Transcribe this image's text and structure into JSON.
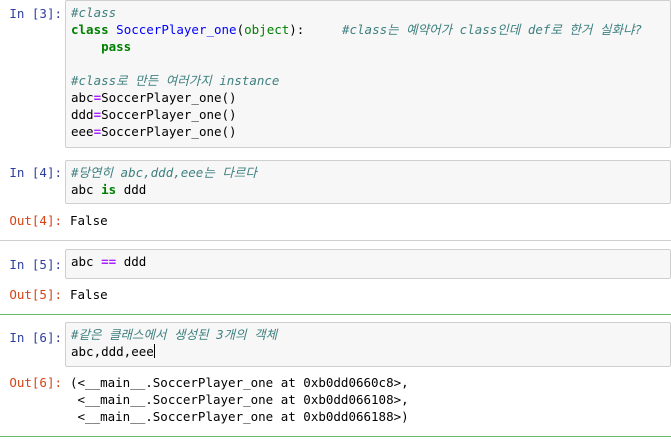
{
  "cells": [
    {
      "in_prompt": "In [3]:",
      "lines": [
        [
          {
            "t": "#class",
            "c": "cm-comment"
          }
        ],
        [
          {
            "t": "class",
            "c": "cm-keyword"
          },
          {
            "t": " ",
            "c": ""
          },
          {
            "t": "SoccerPlayer_one",
            "c": "cm-def"
          },
          {
            "t": "(",
            "c": ""
          },
          {
            "t": "object",
            "c": "cm-builtin"
          },
          {
            "t": "):     ",
            "c": ""
          },
          {
            "t": "#class는 예약어가 class인데 def로 한거 실화냐?",
            "c": "cm-comment"
          }
        ],
        [
          {
            "t": "    ",
            "c": ""
          },
          {
            "t": "pass",
            "c": "cm-keyword"
          }
        ],
        [
          {
            "t": "",
            "c": ""
          }
        ],
        [
          {
            "t": "#class로 만든 여러가지 instance",
            "c": "cm-comment"
          }
        ],
        [
          {
            "t": "abc",
            "c": ""
          },
          {
            "t": "=",
            "c": "cm-operator"
          },
          {
            "t": "SoccerPlayer_one()",
            "c": ""
          }
        ],
        [
          {
            "t": "ddd",
            "c": ""
          },
          {
            "t": "=",
            "c": "cm-operator"
          },
          {
            "t": "SoccerPlayer_one()",
            "c": ""
          }
        ],
        [
          {
            "t": "eee",
            "c": ""
          },
          {
            "t": "=",
            "c": "cm-operator"
          },
          {
            "t": "SoccerPlayer_one()",
            "c": ""
          }
        ]
      ]
    },
    {
      "in_prompt": "In [4]:",
      "lines": [
        [
          {
            "t": "#당연히 abc,ddd,eee는 다르다",
            "c": "cm-comment"
          }
        ],
        [
          {
            "t": "abc ",
            "c": ""
          },
          {
            "t": "is",
            "c": "cm-keyword"
          },
          {
            "t": " ddd",
            "c": ""
          }
        ]
      ],
      "out_prompt": "Out[4]:",
      "output": [
        "False"
      ]
    },
    {
      "in_prompt": "In [5]:",
      "lines": [
        [
          {
            "t": "abc ",
            "c": ""
          },
          {
            "t": "==",
            "c": "cm-operator"
          },
          {
            "t": " ddd",
            "c": ""
          }
        ]
      ],
      "out_prompt": "Out[5]:",
      "output": [
        "False"
      ]
    },
    {
      "in_prompt": "In [6]:",
      "lines": [
        [
          {
            "t": "#같은 클래스에서 생성된 3개의 객체",
            "c": "cm-comment"
          }
        ],
        [
          {
            "t": "abc,ddd,eee",
            "c": ""
          }
        ]
      ],
      "out_prompt": "Out[6]:",
      "output": [
        "(<__main__.SoccerPlayer_one at 0xb0dd0660c8>,",
        " <__main__.SoccerPlayer_one at 0xb0dd066108>,",
        " <__main__.SoccerPlayer_one at 0xb0dd066188>)"
      ]
    }
  ]
}
